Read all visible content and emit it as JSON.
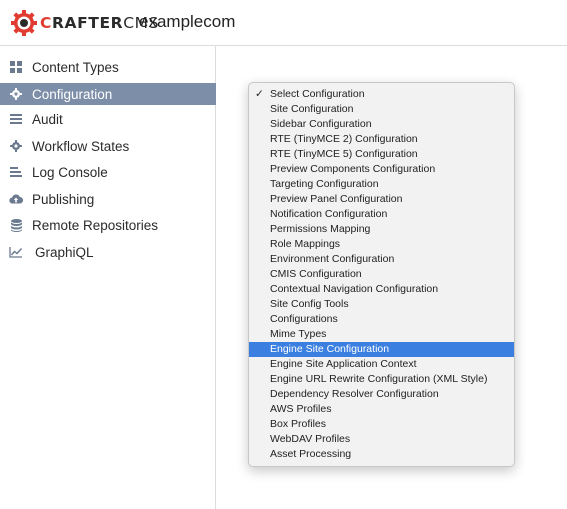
{
  "header": {
    "logo": {
      "prefix": "C",
      "bold": "RAFTER",
      "suffix": "CMS"
    },
    "site_name": "examplecom"
  },
  "sidebar": {
    "items": [
      {
        "label": "Content Types",
        "icon": "grid-icon",
        "active": false
      },
      {
        "label": "Configuration",
        "icon": "gear-icon",
        "active": true
      },
      {
        "label": "Audit",
        "icon": "list-icon",
        "active": false
      },
      {
        "label": "Workflow States",
        "icon": "gear-icon",
        "active": false
      },
      {
        "label": "Log Console",
        "icon": "text-lines-icon",
        "active": false
      },
      {
        "label": "Publishing",
        "icon": "cloud-upload-icon",
        "active": false
      },
      {
        "label": "Remote Repositories",
        "icon": "database-icon",
        "active": false
      },
      {
        "label": "GraphiQL",
        "icon": "line-chart-icon",
        "active": false
      }
    ]
  },
  "dropdown": {
    "selected_index": 0,
    "highlighted_index": 17,
    "options": [
      "Select Configuration",
      "Site Configuration",
      "Sidebar Configuration",
      "RTE (TinyMCE 2) Configuration",
      "RTE (TinyMCE 5) Configuration",
      "Preview Components Configuration",
      "Targeting Configuration",
      "Preview Panel Configuration",
      "Notification Configuration",
      "Permissions Mapping",
      "Role Mappings",
      "Environment Configuration",
      "CMIS Configuration",
      "Contextual Navigation Configuration",
      "Site Config Tools",
      "Configurations",
      "Mime Types",
      "Engine Site Configuration",
      "Engine Site Application Context",
      "Engine URL Rewrite Configuration (XML Style)",
      "Dependency Resolver Configuration",
      "AWS Profiles",
      "Box Profiles",
      "WebDAV Profiles",
      "Asset Processing"
    ]
  },
  "colors": {
    "sidebar_active": "#7d8ea8",
    "highlight": "#3b7fe0",
    "brand_red": "#e03c31"
  }
}
